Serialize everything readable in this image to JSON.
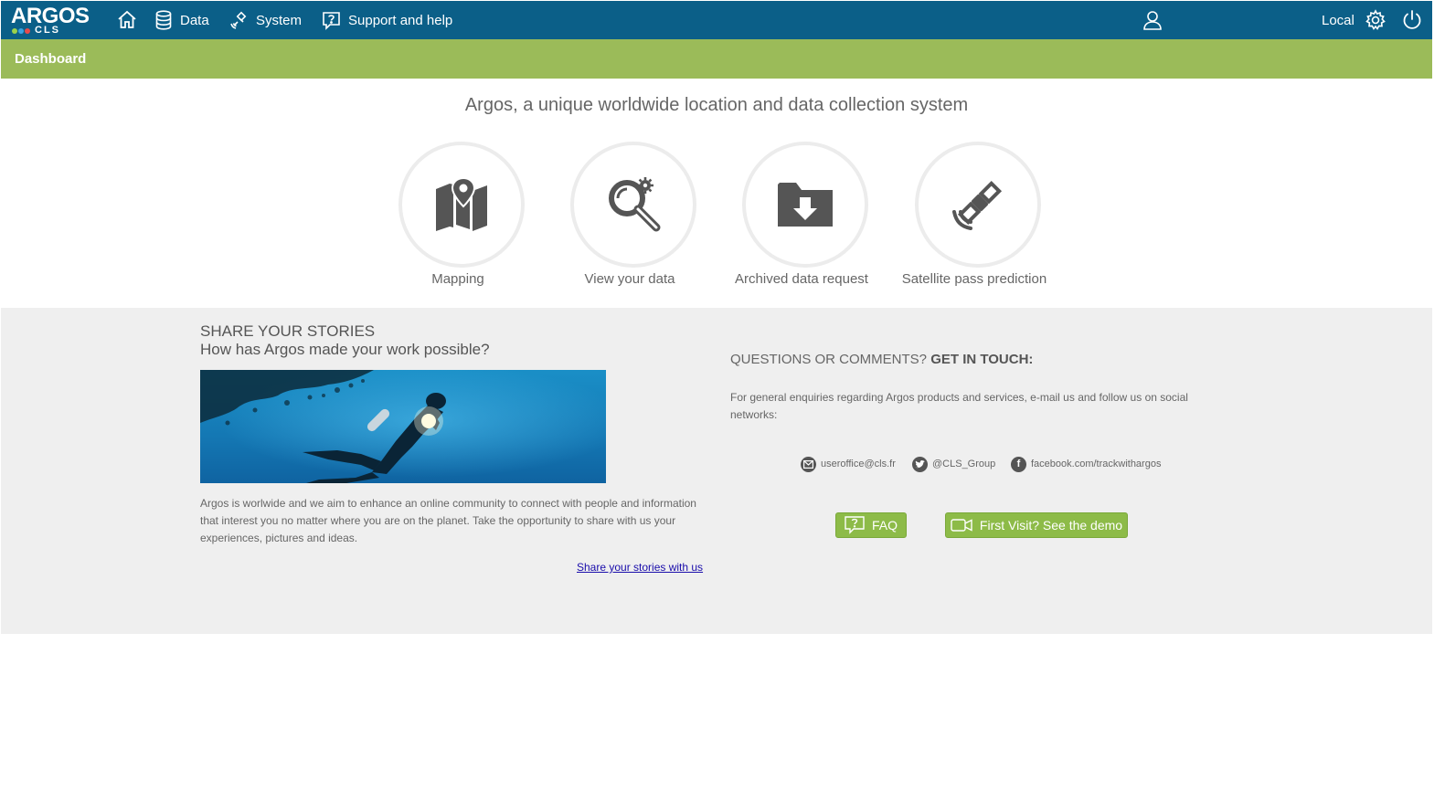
{
  "app": {
    "logo_main": "ARGOS",
    "logo_sub": "CLS"
  },
  "nav": {
    "home_icon": "home-icon",
    "data_label": "Data",
    "system_label": "System",
    "support_label": "Support and help",
    "user_icon": "user-icon",
    "local_label": "Local",
    "settings_icon": "gear-icon",
    "power_icon": "power-icon"
  },
  "subbar": {
    "title": "Dashboard"
  },
  "hero": {
    "tagline": "Argos, a unique worldwide location and data collection system",
    "tiles": [
      {
        "label": "Mapping",
        "icon": "map-pin-icon"
      },
      {
        "label": "View your data",
        "icon": "magnifier-gear-icon"
      },
      {
        "label": "Archived data request",
        "icon": "folder-download-icon"
      },
      {
        "label": "Satellite pass prediction",
        "icon": "satellite-icon"
      }
    ]
  },
  "stories": {
    "title_line1": "SHARE YOUR STORIES",
    "title_line2": "How has Argos made your work possible?",
    "body": "Argos is worlwide and we aim to enhance an online community to connect with people and information that interest you no matter where you are on the planet. Take the opportunity to share with us your experiences, pictures and ideas.",
    "link": "Share your stories with us"
  },
  "contact": {
    "title_normal": "QUESTIONS OR COMMENTS? ",
    "title_bold": "GET IN TOUCH:",
    "body": "For general enquiries regarding Argos products and services, e-mail us and follow us on social networks:",
    "email": "useroffice@cls.fr",
    "twitter": "@CLS_Group",
    "facebook": "facebook.com/trackwithargos",
    "faq_button": "FAQ",
    "demo_button": "First Visit? See the demo"
  },
  "colors": {
    "topbar": "#0b5f88",
    "subbar": "#9bbb59",
    "button_green": "#8dbb48",
    "section_grey": "#efefef"
  }
}
